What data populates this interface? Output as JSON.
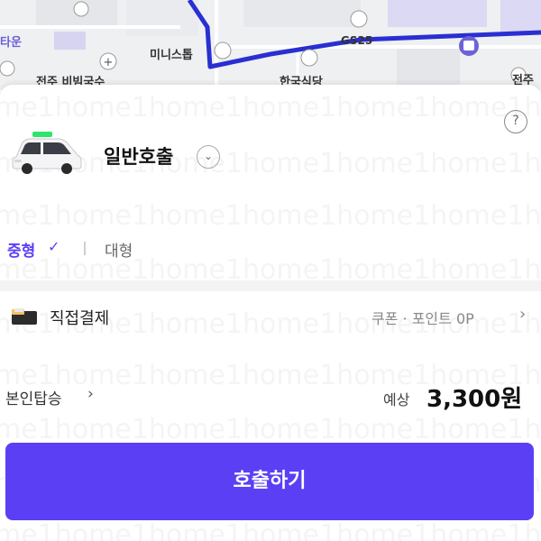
{
  "map": {
    "labels": {
      "left_edge": "타운",
      "mini_stop": "미니스톱",
      "gs25": "GS25",
      "jeonju_partial": "전주",
      "bottom_left": "전주 비빔국수",
      "hanguk_sikdang": "한국식당",
      "jeonju_right": "전주"
    }
  },
  "watermark_text": "me1home1home1home1home1home1home1h",
  "help": {
    "label": "?"
  },
  "service": {
    "name": "일반호출",
    "dropdown_icon": "chevron-down-icon"
  },
  "size_options": {
    "selected": "중형",
    "check": "✓",
    "other": "대형"
  },
  "payment": {
    "method": "직접결제",
    "coupon_point": "쿠폰 · 포인트 0P",
    "arrow": "›"
  },
  "boarding": {
    "label": "본인탑승",
    "arrow": "›"
  },
  "fare": {
    "estimate_label": "예상",
    "amount": "3,300원"
  },
  "call_button": {
    "label": "호출하기"
  },
  "colors": {
    "accent": "#5b3ff5",
    "route": "#2a2fd1",
    "taxi_top": "#2ee56a"
  }
}
